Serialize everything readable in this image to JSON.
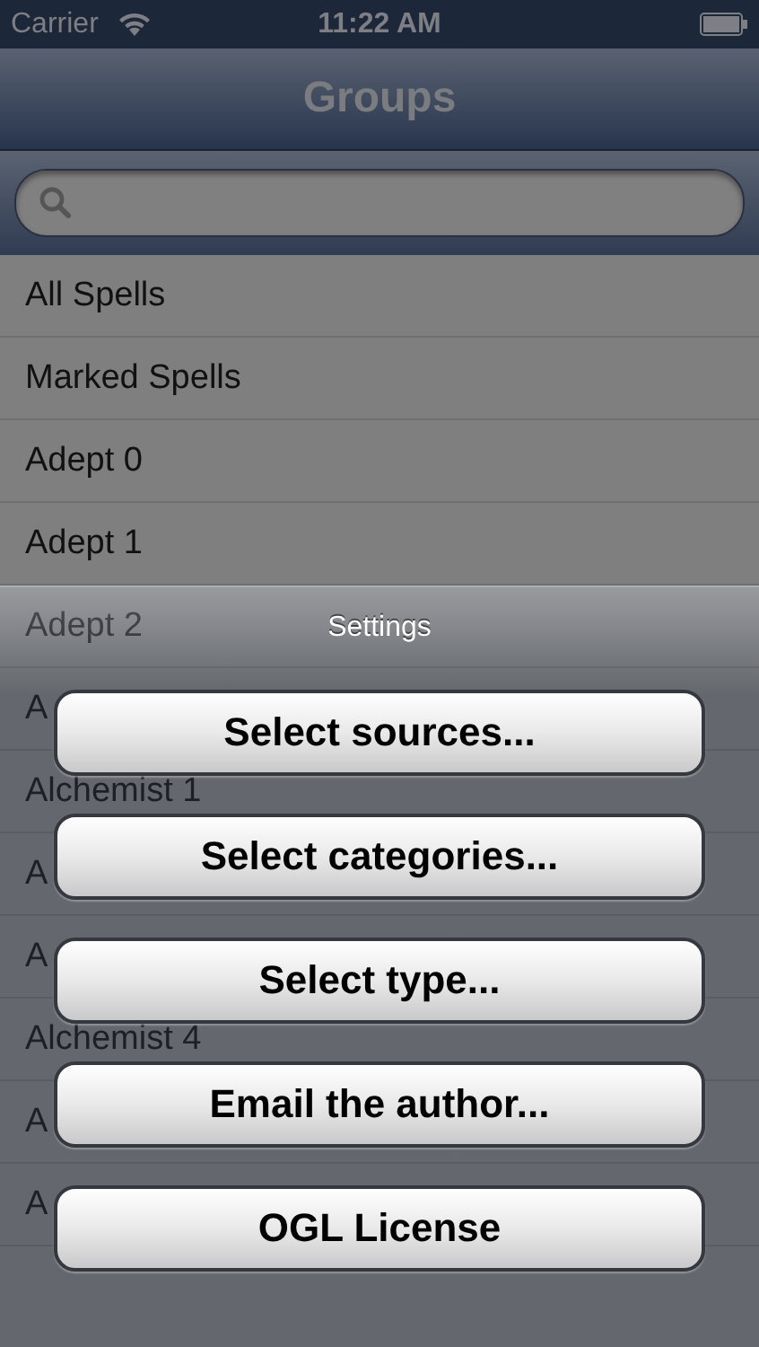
{
  "status_bar": {
    "carrier": "Carrier",
    "time": "11:22 AM"
  },
  "nav_bar": {
    "title": "Groups"
  },
  "rows": [
    "All Spells",
    "Marked Spells",
    "Adept 0",
    "Adept 1",
    "Adept 2",
    "A",
    "Alchemist 1",
    "A",
    "A",
    "Alchemist 4",
    "A",
    "A"
  ],
  "action_sheet": {
    "title": "Settings",
    "buttons": [
      "Select sources...",
      "Select categories...",
      "Select type...",
      "Email the author...",
      "OGL License"
    ]
  }
}
